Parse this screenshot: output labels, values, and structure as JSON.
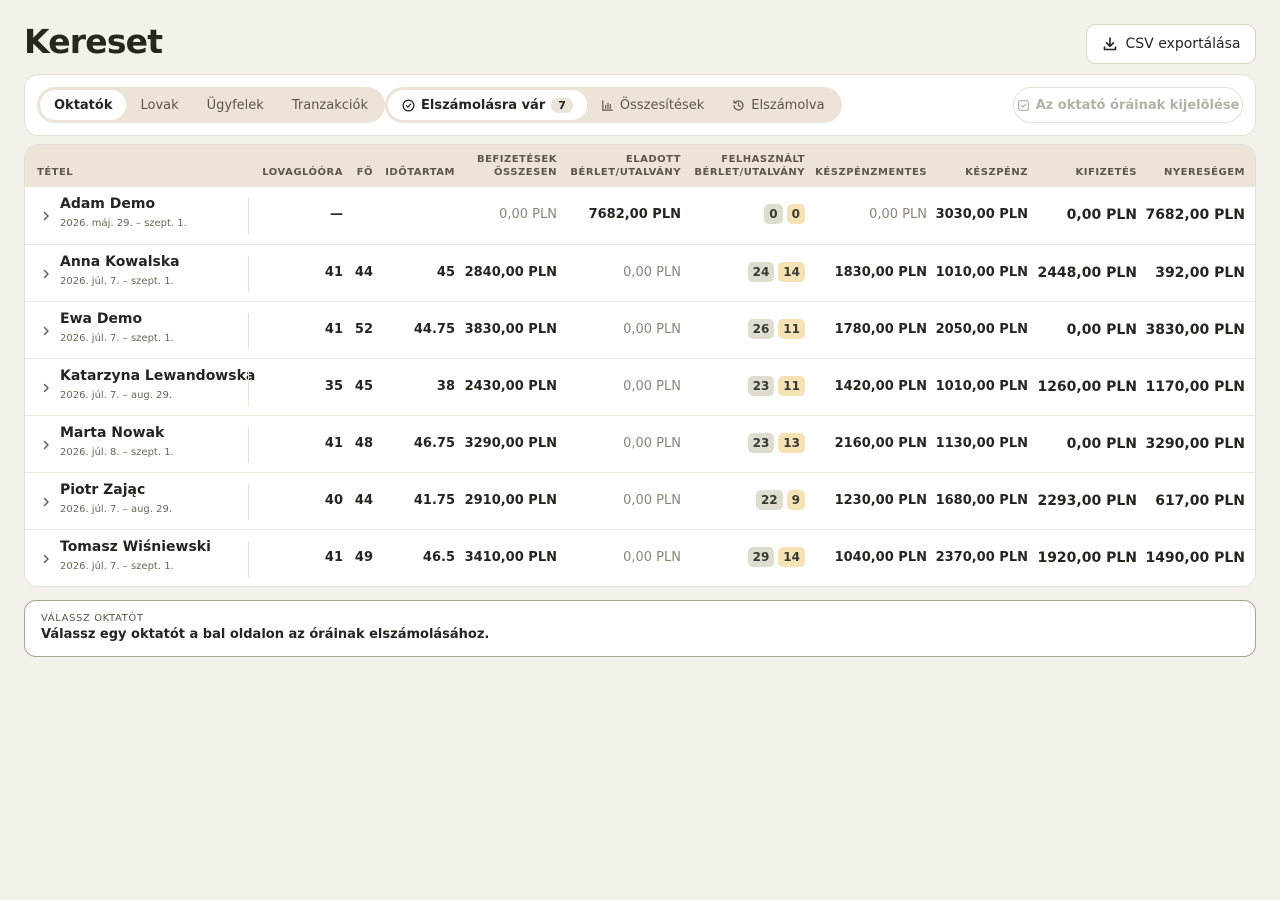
{
  "header": {
    "title": "Kereset",
    "export_label": "CSV exportálása"
  },
  "toolbar": {
    "tabs": [
      "Oktatók",
      "Lovak",
      "Ügyfelek",
      "Tranzakciók"
    ],
    "views": [
      {
        "label": "Elszámolásra vár",
        "icon": "check-circle-icon",
        "count": "7"
      },
      {
        "label": "Összesítések",
        "icon": "bar-chart-icon"
      },
      {
        "label": "Elszámolva",
        "icon": "history-icon"
      }
    ],
    "select_label": "Az oktató óráinak kijelölése"
  },
  "table": {
    "columns": {
      "item": "TÉTEL",
      "lesson_hours": "LOVAGLÓÓRA",
      "persons": "FŐ",
      "duration": "IDŐTARTAM",
      "payments_1": "BEFIZETÉSEK",
      "payments_2": "ÖSSZESEN",
      "sold_1": "ELADOTT",
      "sold_2": "BÉRLET/UTALVÁNY",
      "used_1": "FELHASZNÁLT",
      "used_2": "BÉRLET/UTALVÁNY",
      "cashless": "KÉSZPÉNZMENTES",
      "cash": "KÉSZPÉNZ",
      "payout": "KIFIZETÉS",
      "profit": "NYERESÉGEM"
    },
    "rows": [
      {
        "name": "Adam Demo",
        "date": "2026. máj. 29. – szept. 1.",
        "hours": "—",
        "persons": "",
        "duration": "",
        "payments": "0,00 PLN",
        "sold": "7682,00 PLN",
        "used_a": "0",
        "used_b": "0",
        "cashless": "0,00 PLN",
        "cash": "3030,00 PLN",
        "payout": "0,00 PLN",
        "profit": "7682,00 PLN"
      },
      {
        "name": "Anna Kowalska",
        "date": "2026. júl. 7. – szept. 1.",
        "hours": "41",
        "persons": "44",
        "duration": "45",
        "payments": "2840,00 PLN",
        "sold": "0,00 PLN",
        "used_a": "24",
        "used_b": "14",
        "cashless": "1830,00 PLN",
        "cash": "1010,00 PLN",
        "payout": "2448,00 PLN",
        "profit": "392,00 PLN"
      },
      {
        "name": "Ewa Demo",
        "date": "2026. júl. 7. – szept. 1.",
        "hours": "41",
        "persons": "52",
        "duration": "44.75",
        "payments": "3830,00 PLN",
        "sold": "0,00 PLN",
        "used_a": "26",
        "used_b": "11",
        "cashless": "1780,00 PLN",
        "cash": "2050,00 PLN",
        "payout": "0,00 PLN",
        "profit": "3830,00 PLN"
      },
      {
        "name": "Katarzyna Lewandowska",
        "date": "2026. júl. 7. – aug. 29.",
        "hours": "35",
        "persons": "45",
        "duration": "38",
        "payments": "2430,00 PLN",
        "sold": "0,00 PLN",
        "used_a": "23",
        "used_b": "11",
        "cashless": "1420,00 PLN",
        "cash": "1010,00 PLN",
        "payout": "1260,00 PLN",
        "profit": "1170,00 PLN"
      },
      {
        "name": "Marta Nowak",
        "date": "2026. júl. 8. – szept. 1.",
        "hours": "41",
        "persons": "48",
        "duration": "46.75",
        "payments": "3290,00 PLN",
        "sold": "0,00 PLN",
        "used_a": "23",
        "used_b": "13",
        "cashless": "2160,00 PLN",
        "cash": "1130,00 PLN",
        "payout": "0,00 PLN",
        "profit": "3290,00 PLN"
      },
      {
        "name": "Piotr Zając",
        "date": "2026. júl. 7. – aug. 29.",
        "hours": "40",
        "persons": "44",
        "duration": "41.75",
        "payments": "2910,00 PLN",
        "sold": "0,00 PLN",
        "used_a": "22",
        "used_b": "9",
        "cashless": "1230,00 PLN",
        "cash": "1680,00 PLN",
        "payout": "2293,00 PLN",
        "profit": "617,00 PLN"
      },
      {
        "name": "Tomasz Wiśniewski",
        "date": "2026. júl. 7. – szept. 1.",
        "hours": "41",
        "persons": "49",
        "duration": "46.5",
        "payments": "3410,00 PLN",
        "sold": "0,00 PLN",
        "used_a": "29",
        "used_b": "14",
        "cashless": "1040,00 PLN",
        "cash": "2370,00 PLN",
        "payout": "1920,00 PLN",
        "profit": "1490,00 PLN"
      }
    ]
  },
  "info": {
    "label": "VÁLASSZ OKTATÓT",
    "text": "Válassz egy oktatót a bal oldalon az óráinak elszámolásához."
  }
}
